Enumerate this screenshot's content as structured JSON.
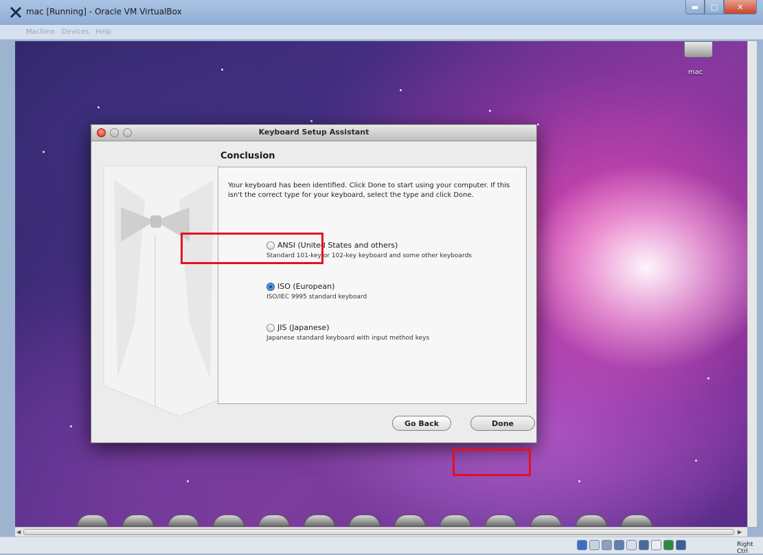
{
  "host_window": {
    "title": "mac [Running] - Oracle VM VirtualBox",
    "menu": [
      "Machine",
      "Devices",
      "Help"
    ],
    "host_key_label": "Right Ctrl"
  },
  "desktop": {
    "drive_label": "mac"
  },
  "dialog": {
    "title": "Keyboard Setup Assistant",
    "section_title": "Conclusion",
    "intro": "Your keyboard has been identified. Click Done to start using your computer. If this isn't the correct type for your keyboard, select the type and click Done.",
    "options": [
      {
        "label": "ANSI (United States and others)",
        "description": "Standard 101-key or 102-key keyboard and some other keyboards",
        "selected": false
      },
      {
        "label": "ISO (European)",
        "description": "ISO/IEC 9995 standard keyboard",
        "selected": true
      },
      {
        "label": "JIS (Japanese)",
        "description": "Japanese standard keyboard with input method keys",
        "selected": false
      }
    ],
    "buttons": {
      "back": "Go Back",
      "done": "Done"
    }
  },
  "colors": {
    "highlight": "#e3101f",
    "radio_selected": "#3e7bd2"
  }
}
